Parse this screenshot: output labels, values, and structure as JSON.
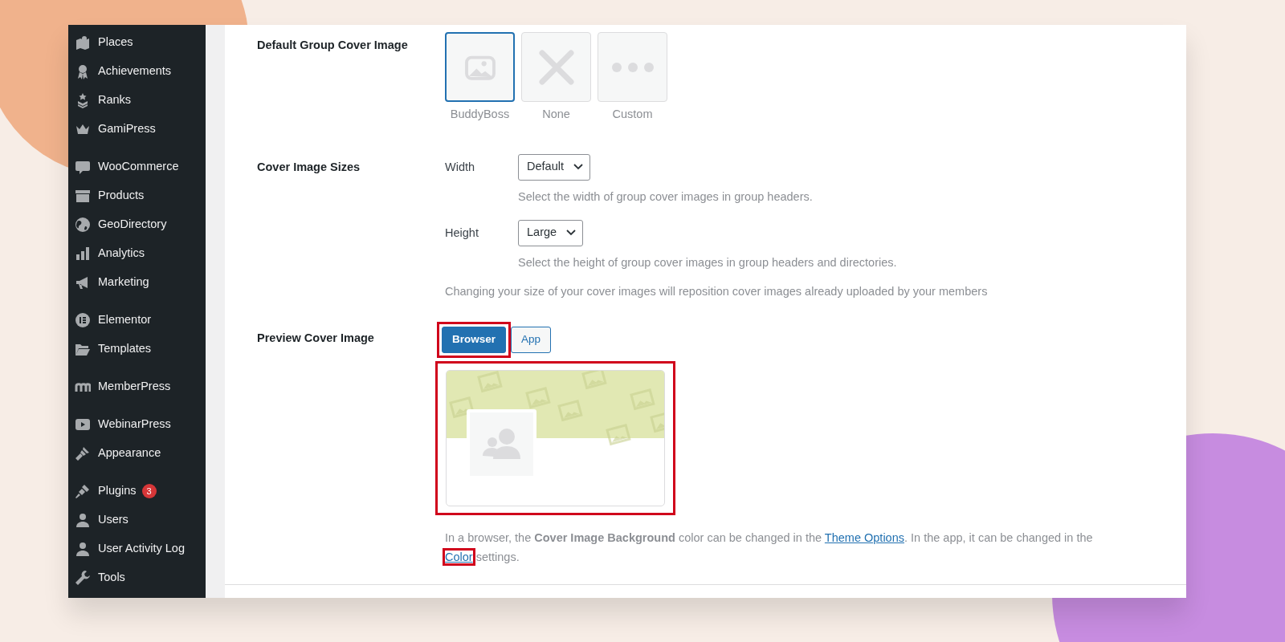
{
  "sidebar": {
    "groups": [
      [
        {
          "label": "Places"
        },
        {
          "label": "Achievements"
        },
        {
          "label": "Ranks"
        },
        {
          "label": "GamiPress"
        }
      ],
      [
        {
          "label": "WooCommerce"
        },
        {
          "label": "Products"
        },
        {
          "label": "GeoDirectory"
        },
        {
          "label": "Analytics"
        },
        {
          "label": "Marketing"
        }
      ],
      [
        {
          "label": "Elementor"
        },
        {
          "label": "Templates"
        }
      ],
      [
        {
          "label": "MemberPress"
        }
      ],
      [
        {
          "label": "WebinarPress"
        },
        {
          "label": "Appearance"
        }
      ],
      [
        {
          "label": "Plugins",
          "badge": "3"
        },
        {
          "label": "Users"
        },
        {
          "label": "User Activity Log"
        },
        {
          "label": "Tools"
        }
      ]
    ]
  },
  "settings": {
    "default_cover": {
      "label": "Default Group Cover Image",
      "options": [
        {
          "kind": "pattern",
          "label": "BuddyBoss",
          "selected": true
        },
        {
          "kind": "none",
          "label": "None",
          "selected": false
        },
        {
          "kind": "custom",
          "label": "Custom",
          "selected": false
        }
      ]
    },
    "sizes": {
      "label": "Cover Image Sizes",
      "fields": [
        {
          "label": "Width",
          "value": "Default",
          "help": "Select the width of group cover images in group headers."
        },
        {
          "label": "Height",
          "value": "Large",
          "help": "Select the height of group cover images in group headers and directories."
        }
      ],
      "note": "Changing your size of your cover images will reposition cover images already uploaded by your members"
    },
    "preview": {
      "label": "Preview Cover Image",
      "toggle": [
        {
          "label": "Browser",
          "selected": true,
          "highlighted": true
        },
        {
          "label": "App",
          "selected": false,
          "highlighted": false
        }
      ],
      "preview_highlighted": true,
      "note": [
        {
          "kind": "text",
          "text": "In a browser, the **Cover Image Background** color can be changed in the "
        },
        {
          "kind": "link",
          "text": "Theme Options",
          "highlighted": false
        },
        {
          "kind": "text",
          "text": ". In the app, it can be changed in the "
        },
        {
          "kind": "link",
          "text": "Color",
          "highlighted": true
        },
        {
          "kind": "text",
          "text": " settings."
        }
      ]
    }
  }
}
